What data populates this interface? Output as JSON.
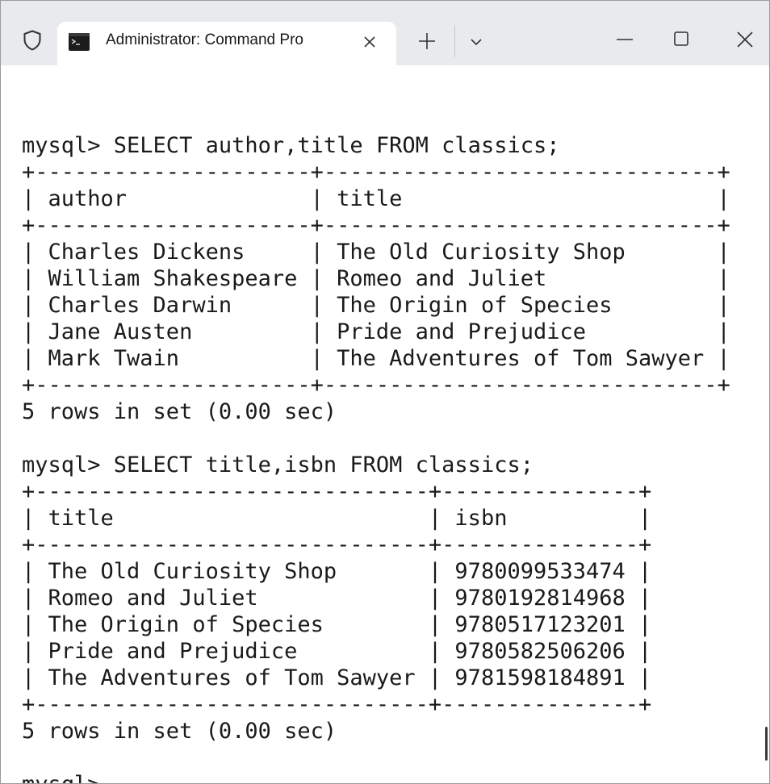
{
  "window": {
    "tab_title": "Administrator: Command Pro",
    "icons": {
      "shield": "shield-icon",
      "tab": "command-prompt-icon",
      "tab_close": "close-icon",
      "new_tab": "plus-icon",
      "dropdown": "chevron-down-icon",
      "minimize": "minimize-icon",
      "maximize": "maximize-icon",
      "close": "close-icon"
    }
  },
  "console": {
    "lines": [
      "",
      "mysql> SELECT author,title FROM classics;",
      "+---------------------+------------------------------+",
      "| author              | title                        |",
      "+---------------------+------------------------------+",
      "| Charles Dickens     | The Old Curiosity Shop       |",
      "| William Shakespeare | Romeo and Juliet             |",
      "| Charles Darwin      | The Origin of Species        |",
      "| Jane Austen         | Pride and Prejudice          |",
      "| Mark Twain          | The Adventures of Tom Sawyer |",
      "+---------------------+------------------------------+",
      "5 rows in set (0.00 sec)",
      "",
      "mysql> SELECT title,isbn FROM classics;",
      "+------------------------------+---------------+",
      "| title                        | isbn          |",
      "+------------------------------+---------------+",
      "| The Old Curiosity Shop       | 9780099533474 |",
      "| Romeo and Juliet             | 9780192814968 |",
      "| The Origin of Species        | 9780517123201 |",
      "| Pride and Prejudice          | 9780582506206 |",
      "| The Adventures of Tom Sawyer | 9781598184891 |",
      "+------------------------------+---------------+",
      "5 rows in set (0.00 sec)",
      "",
      "mysql>"
    ]
  }
}
